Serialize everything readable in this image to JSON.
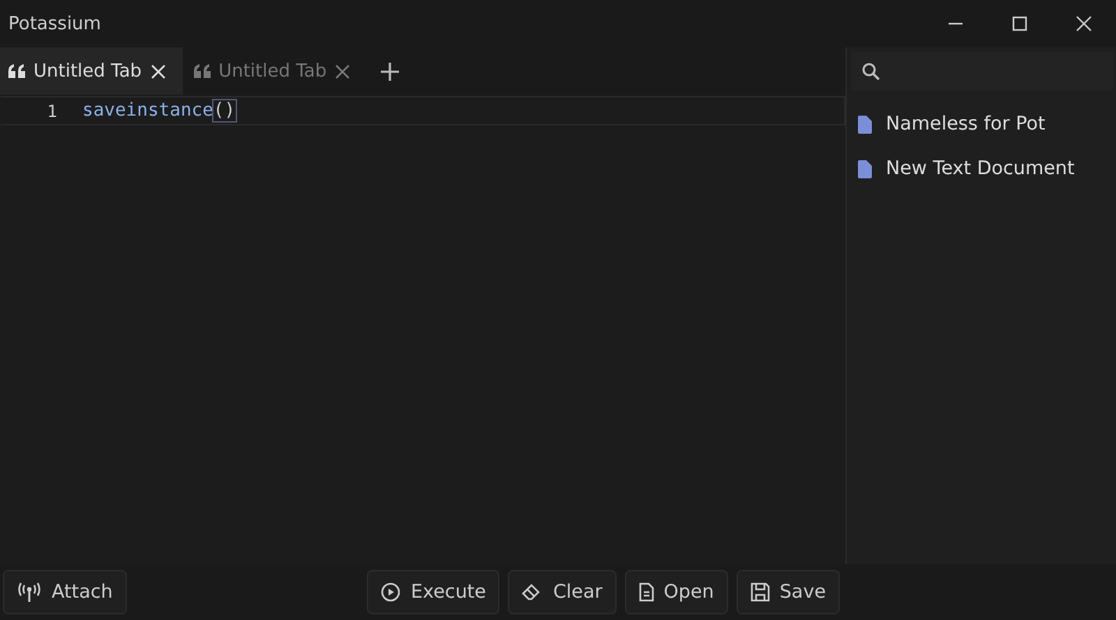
{
  "window": {
    "title": "Potassium"
  },
  "tabs": [
    {
      "label": "Untitled Tab",
      "selected": true
    },
    {
      "label": "Untitled Tab",
      "selected": false
    }
  ],
  "editor": {
    "lines": [
      {
        "number": "1",
        "current": true,
        "tokens": [
          {
            "text": "saveinstance",
            "kind": "function"
          },
          {
            "text": "()",
            "kind": "matched-brackets"
          }
        ]
      }
    ]
  },
  "sidebar": {
    "files": [
      {
        "name": "Nameless for Pot"
      },
      {
        "name": "New Text Document"
      }
    ]
  },
  "footer": {
    "left_buttons": [
      {
        "label": "Attach",
        "kind": "antenna"
      }
    ],
    "right_buttons": [
      {
        "label": "Execute",
        "kind": "play"
      },
      {
        "label": "Clear",
        "kind": "eraser"
      },
      {
        "label": "Open",
        "kind": "file"
      },
      {
        "label": "Save",
        "kind": "disk"
      }
    ]
  }
}
